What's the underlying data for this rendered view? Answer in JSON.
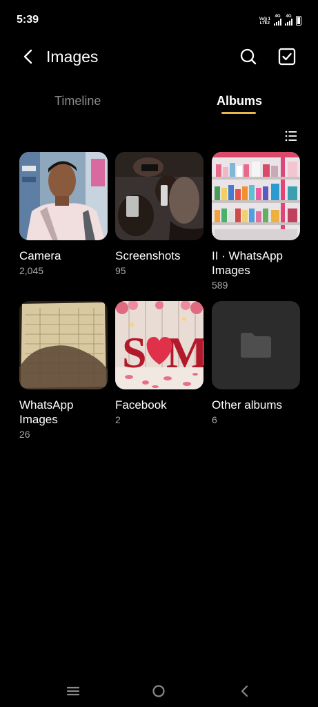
{
  "status": {
    "time": "5:39",
    "sim1_label_top": "Vo)) 1",
    "sim1_label_bottom": "LTE2",
    "sim1_net": "4G",
    "sim2_net": "4G"
  },
  "header": {
    "title": "Images",
    "icons": [
      "back-arrow-icon",
      "search-icon",
      "select-checkbox-icon"
    ]
  },
  "tabs": [
    {
      "label": "Timeline",
      "active": false
    },
    {
      "label": "Albums",
      "active": true
    }
  ],
  "accent_color": "#e8b84a",
  "toolbar": {
    "icon": "list-view-icon"
  },
  "albums": [
    {
      "name": "Camera",
      "count": "2,045"
    },
    {
      "name": "Screenshots",
      "count": "95"
    },
    {
      "name": "II · WhatsApp Images",
      "count": "589"
    },
    {
      "name": "WhatsApp Images",
      "count": "26"
    },
    {
      "name": "Facebook",
      "count": "2"
    },
    {
      "name": "Other albums",
      "count": "6"
    }
  ],
  "nav": {
    "icons": [
      "menu-icon",
      "home-icon",
      "back-icon"
    ]
  }
}
